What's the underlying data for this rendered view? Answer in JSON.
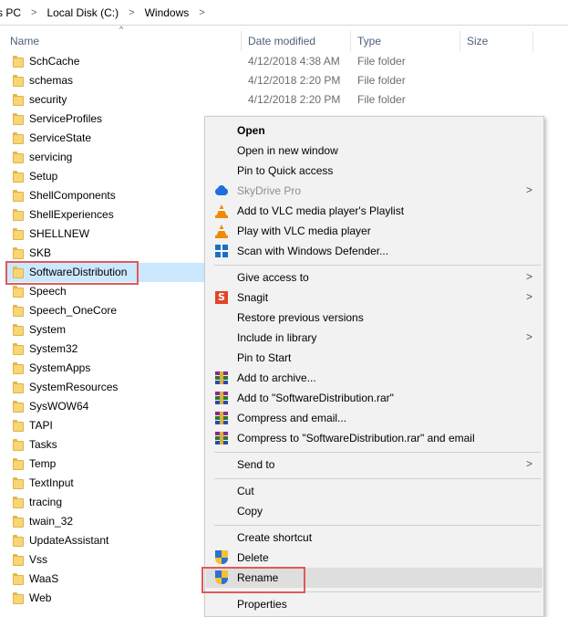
{
  "breadcrumb": {
    "items": [
      "s PC",
      "Local Disk (C:)",
      "Windows"
    ],
    "separator": ">"
  },
  "columns": {
    "name": "Name",
    "date": "Date modified",
    "type": "Type",
    "size": "Size"
  },
  "files": [
    {
      "name": "SchCache",
      "date": "4/12/2018 4:38 AM",
      "type": "File folder"
    },
    {
      "name": "schemas",
      "date": "4/12/2018 2:20 PM",
      "type": "File folder"
    },
    {
      "name": "security",
      "date": "4/12/2018 2:20 PM",
      "type": "File folder"
    },
    {
      "name": "ServiceProfiles",
      "date": "",
      "type": ""
    },
    {
      "name": "ServiceState",
      "date": "",
      "type": ""
    },
    {
      "name": "servicing",
      "date": "",
      "type": ""
    },
    {
      "name": "Setup",
      "date": "",
      "type": ""
    },
    {
      "name": "ShellComponents",
      "date": "",
      "type": ""
    },
    {
      "name": "ShellExperiences",
      "date": "",
      "type": ""
    },
    {
      "name": "SHELLNEW",
      "date": "",
      "type": ""
    },
    {
      "name": "SKB",
      "date": "",
      "type": ""
    },
    {
      "name": "SoftwareDistribution",
      "date": "",
      "type": "",
      "selected": true
    },
    {
      "name": "Speech",
      "date": "",
      "type": ""
    },
    {
      "name": "Speech_OneCore",
      "date": "",
      "type": ""
    },
    {
      "name": "System",
      "date": "",
      "type": ""
    },
    {
      "name": "System32",
      "date": "",
      "type": ""
    },
    {
      "name": "SystemApps",
      "date": "",
      "type": ""
    },
    {
      "name": "SystemResources",
      "date": "",
      "type": ""
    },
    {
      "name": "SysWOW64",
      "date": "",
      "type": ""
    },
    {
      "name": "TAPI",
      "date": "",
      "type": ""
    },
    {
      "name": "Tasks",
      "date": "",
      "type": ""
    },
    {
      "name": "Temp",
      "date": "",
      "type": ""
    },
    {
      "name": "TextInput",
      "date": "",
      "type": ""
    },
    {
      "name": "tracing",
      "date": "",
      "type": ""
    },
    {
      "name": "twain_32",
      "date": "",
      "type": ""
    },
    {
      "name": "UpdateAssistant",
      "date": "",
      "type": ""
    },
    {
      "name": "Vss",
      "date": "",
      "type": ""
    },
    {
      "name": "WaaS",
      "date": "",
      "type": ""
    },
    {
      "name": "Web",
      "date": "",
      "type": ""
    }
  ],
  "context_menu": {
    "open": "Open",
    "open_new_window": "Open in new window",
    "pin_quick_access": "Pin to Quick access",
    "skydrive_pro": "SkyDrive Pro",
    "vlc_playlist": "Add to VLC media player's Playlist",
    "vlc_play": "Play with VLC media player",
    "defender_scan": "Scan with Windows Defender...",
    "give_access": "Give access to",
    "snagit": "Snagit",
    "restore_versions": "Restore previous versions",
    "include_library": "Include in library",
    "pin_start": "Pin to Start",
    "add_archive": "Add to archive...",
    "add_rar": "Add to \"SoftwareDistribution.rar\"",
    "compress_email": "Compress and email...",
    "compress_rar_email": "Compress to \"SoftwareDistribution.rar\" and email",
    "send_to": "Send to",
    "cut": "Cut",
    "copy": "Copy",
    "create_shortcut": "Create shortcut",
    "delete": "Delete",
    "rename": "Rename",
    "properties": "Properties",
    "submenu_arrow": ">"
  },
  "colors": {
    "selection": "#cce8ff",
    "highlight_box": "#e05a5a",
    "menu_bg": "#f2f2f2",
    "menu_hover": "#dedede"
  }
}
